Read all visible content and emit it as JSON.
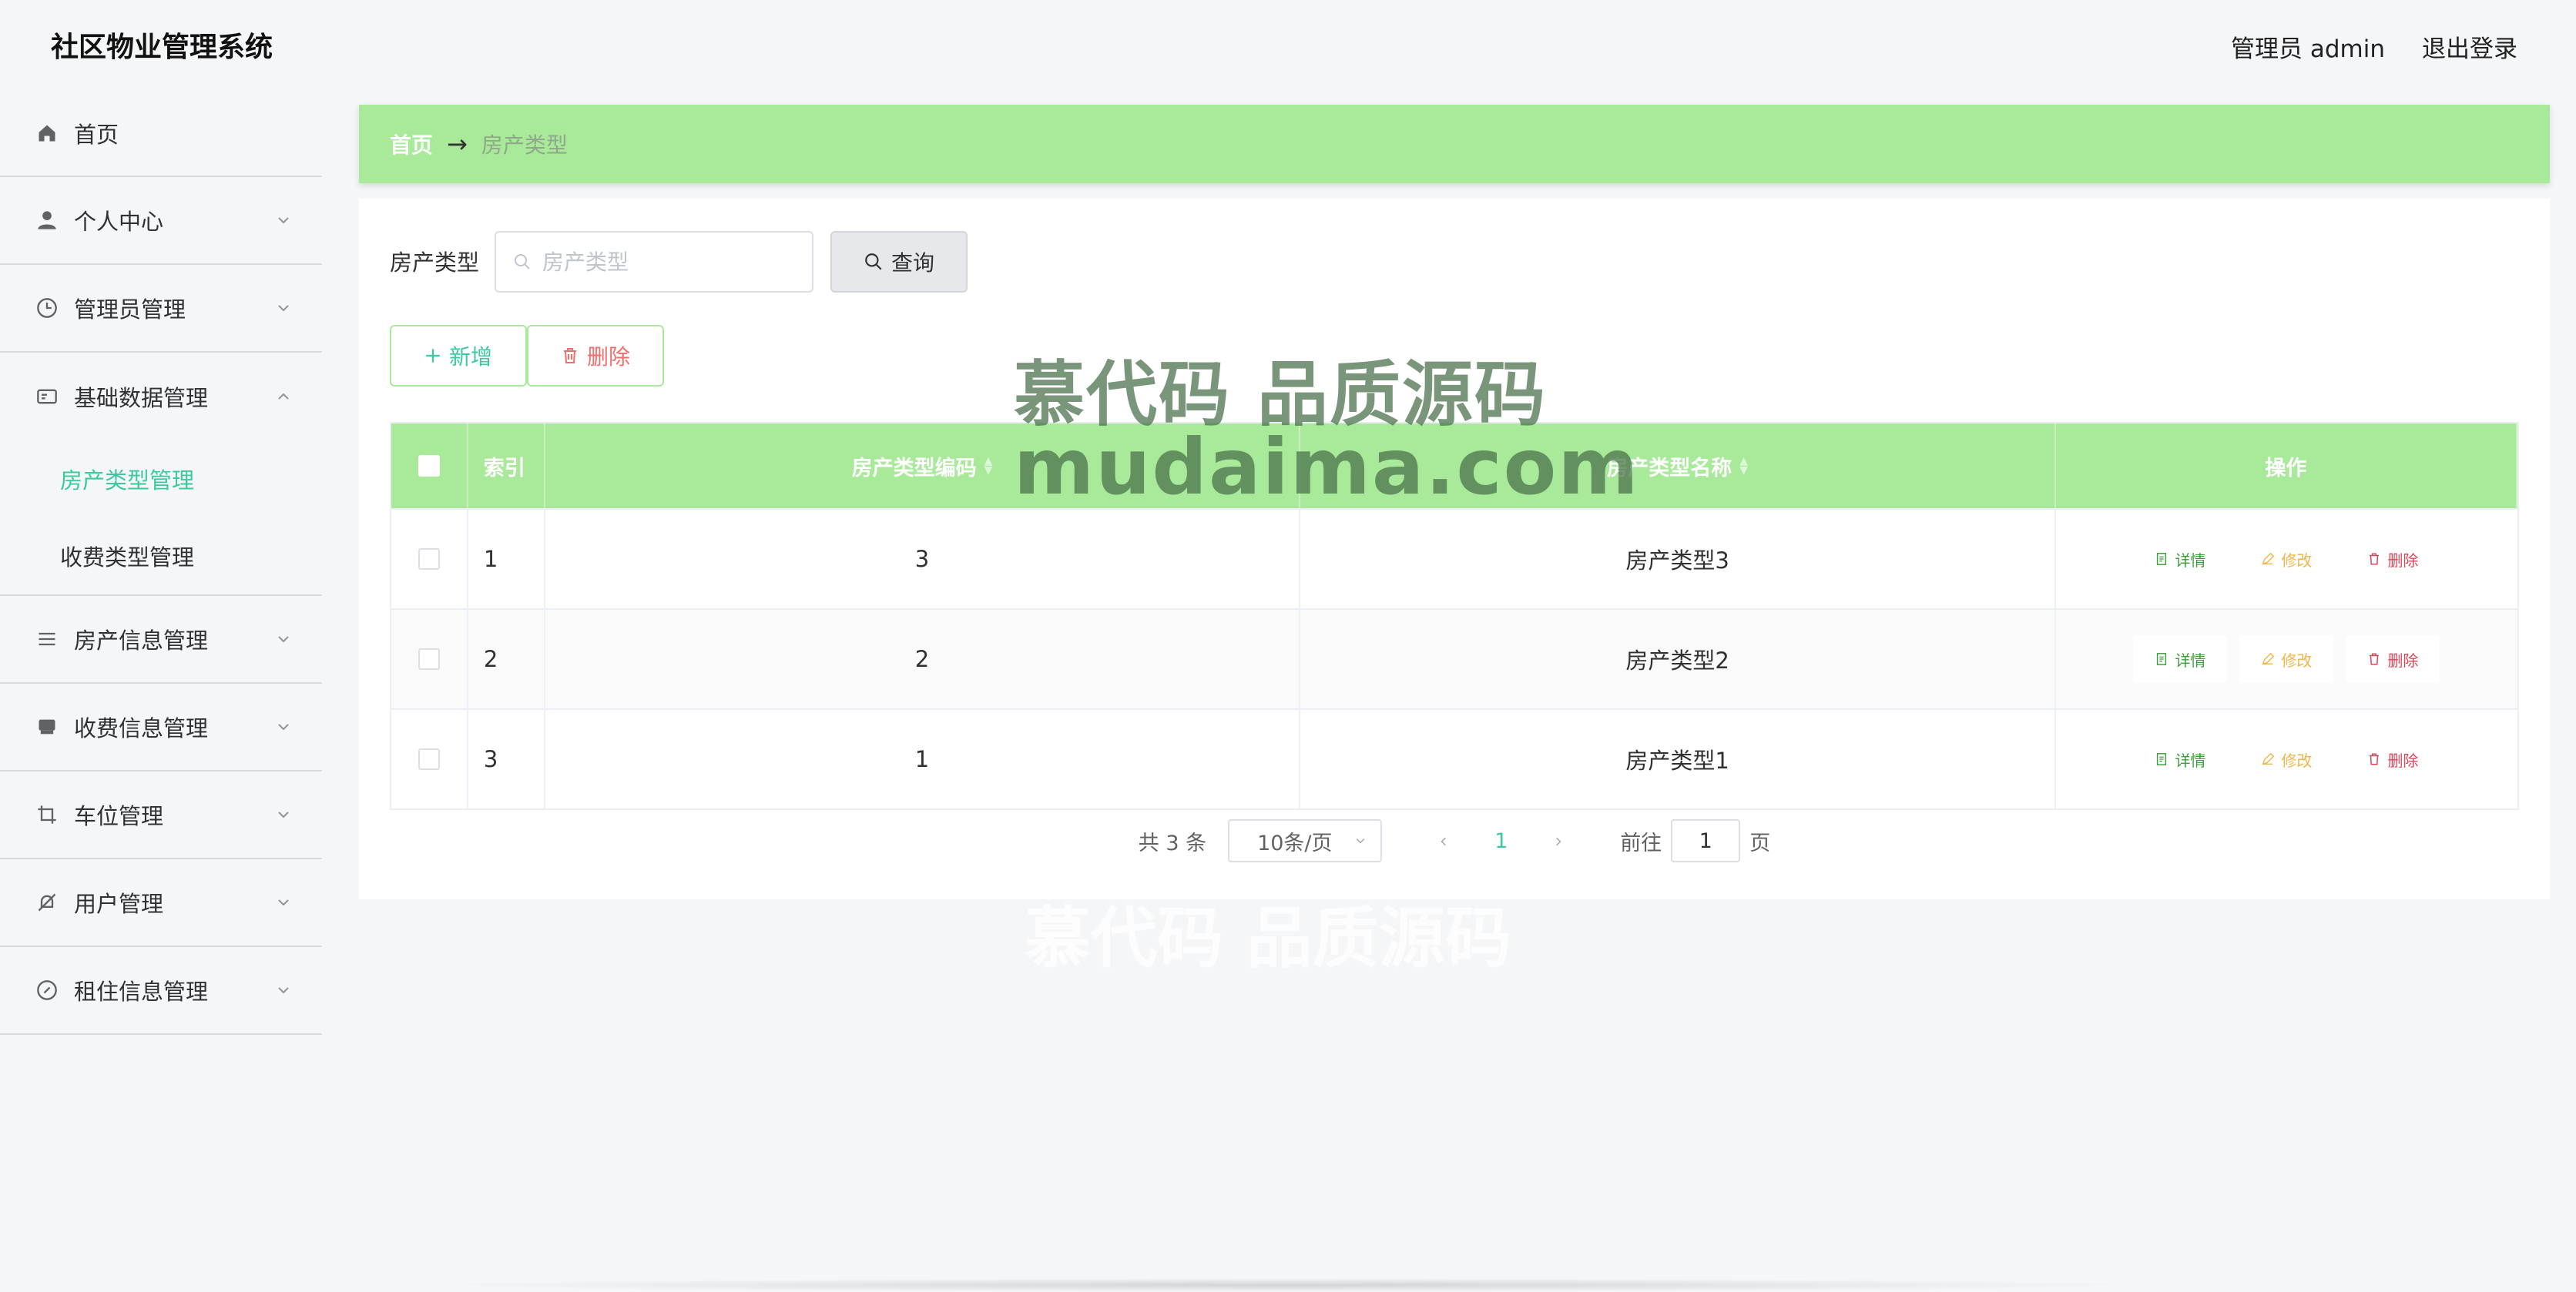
{
  "header": {
    "app_title": "社区物业管理系统",
    "user_label": "管理员 admin",
    "logout": "退出登录"
  },
  "sidebar": {
    "items": [
      {
        "label": "首页",
        "icon": "home-icon"
      },
      {
        "label": "个人中心",
        "icon": "user-icon"
      },
      {
        "label": "管理员管理",
        "icon": "clock-icon"
      },
      {
        "label": "基础数据管理",
        "icon": "card-icon",
        "expanded": true,
        "children": [
          {
            "label": "房产类型管理",
            "active": true
          },
          {
            "label": "收费类型管理"
          }
        ]
      },
      {
        "label": "房产信息管理",
        "icon": "list-icon"
      },
      {
        "label": "收费信息管理",
        "icon": "inbox-icon"
      },
      {
        "label": "车位管理",
        "icon": "crop-icon"
      },
      {
        "label": "用户管理",
        "icon": "bell-off-icon"
      },
      {
        "label": "租住信息管理",
        "icon": "compass-icon"
      }
    ]
  },
  "breadcrumb": {
    "home": "首页",
    "separator": "→",
    "current": "房产类型"
  },
  "search": {
    "label": "房产类型",
    "placeholder": "房产类型",
    "value": "",
    "button": "查询"
  },
  "actions": {
    "add": "新增",
    "delete": "删除"
  },
  "table": {
    "headers": {
      "index": "索引",
      "code": "房产类型编码",
      "name": "房产类型名称",
      "ops": "操作"
    },
    "ops": {
      "detail": "详情",
      "edit": "修改",
      "delete": "删除"
    },
    "rows": [
      {
        "index": "1",
        "code": "3",
        "name": "房产类型3"
      },
      {
        "index": "2",
        "code": "2",
        "name": "房产类型2"
      },
      {
        "index": "3",
        "code": "1",
        "name": "房产类型1"
      }
    ]
  },
  "pagination": {
    "total": "共 3 条",
    "page_size": "10条/页",
    "current_page": "1",
    "goto_prefix": "前往",
    "goto_value": "1",
    "goto_suffix": "页"
  },
  "watermark": {
    "line1": "慕代码 品质源码",
    "line2": "mudaima.com",
    "line3": "慕代码 品质源码"
  },
  "colors": {
    "accent": "#a8ea9a",
    "primary_text": "#3bc9a0",
    "danger": "#f56c6c",
    "edit": "#f2b64c",
    "detail": "#3a9f3a"
  }
}
